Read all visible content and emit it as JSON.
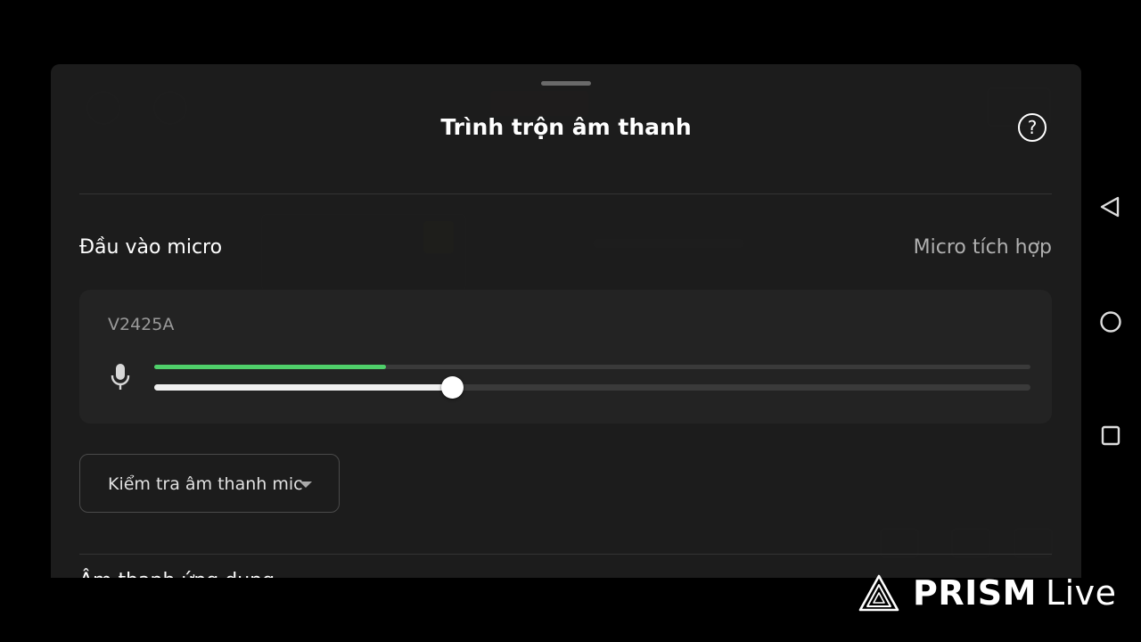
{
  "sheet": {
    "title": "Trình trộn âm thanh",
    "help_icon": "help-circle-icon"
  },
  "mic_input": {
    "label": "Đầu vào micro",
    "value": "Micro tích hợp"
  },
  "device": {
    "name": "V2425A",
    "icon": "microphone-icon",
    "input_level": 0.265,
    "volume": 0.34
  },
  "test_dropdown": {
    "label": "Kiểm tra âm thanh mic"
  },
  "next_section": {
    "label": "Âm thanh ứng dụng"
  },
  "watermark": {
    "brand": "PRISM",
    "suffix": "Live"
  },
  "navbar": {
    "back_icon": "back-triangle-icon",
    "home_icon": "home-circle-icon",
    "recents_icon": "recents-square-icon"
  },
  "colors": {
    "meter": "#4fcf6a",
    "sheet_bg": "#1c1c1c"
  }
}
